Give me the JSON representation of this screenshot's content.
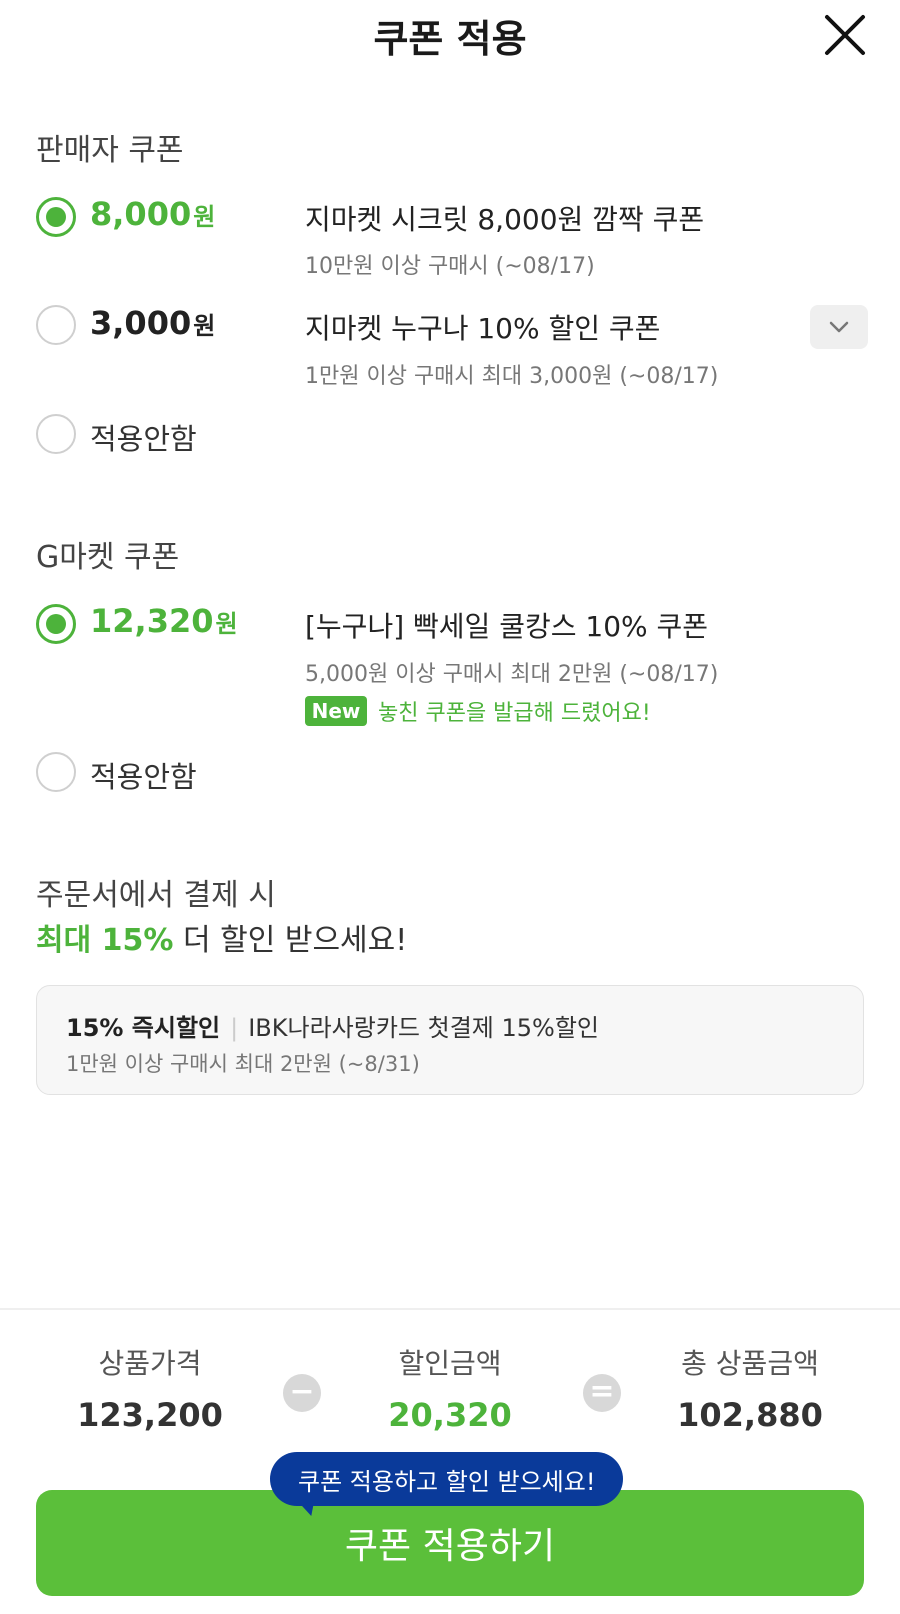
{
  "header": {
    "title": "쿠폰 적용"
  },
  "seller_section": {
    "title": "판매자 쿠폰",
    "coupons": [
      {
        "amount": "8,000",
        "unit": "원",
        "name": "지마켓 시크릿 8,000원 깜짝 쿠폰",
        "condition": "10만원 이상 구매시 (~08/17)",
        "selected": true
      },
      {
        "amount": "3,000",
        "unit": "원",
        "name": "지마켓 누구나 10% 할인 쿠폰",
        "condition": "1만원 이상 구매시 최대 3,000원 (~08/17)",
        "selected": false
      }
    ],
    "no_apply": "적용안함"
  },
  "gmarket_section": {
    "title": "G마켓 쿠폰",
    "coupons": [
      {
        "amount": "12,320",
        "unit": "원",
        "name": "[누구나] 빡세일 쿨캉스 10% 쿠폰",
        "condition": "5,000원 이상 구매시 최대 2만원 (~08/17)",
        "selected": true,
        "badge": "New",
        "note": "놓친 쿠폰을 발급해 드렸어요!"
      }
    ],
    "no_apply": "적용안함"
  },
  "promo": {
    "line1": "주문서에서 결제 시",
    "highlight": "최대 15%",
    "line2_rest": " 더 할인 받으세요!",
    "card": {
      "tag": "15% 즉시할인",
      "separator": "|",
      "title": "IBK나라사랑카드 첫결제 15%할인",
      "condition": "1만원 이상 구매시 최대 2만원 (~8/31)"
    }
  },
  "summary": {
    "price_label": "상품가격",
    "price_value": "123,200",
    "minus": "−",
    "discount_label": "할인금액",
    "discount_value": "20,320",
    "equals": "=",
    "total_label": "총 상품금액",
    "total_value": "102,880"
  },
  "tooltip": "쿠폰 적용하고 할인 받으세요!",
  "apply_button": "쿠폰 적용하기",
  "colors": {
    "accent": "#4db33b",
    "button": "#5bbf3a",
    "tooltip": "#0a3a9a"
  },
  "icons": {
    "close": "close-icon",
    "dropdown": "chevron-down-icon"
  }
}
